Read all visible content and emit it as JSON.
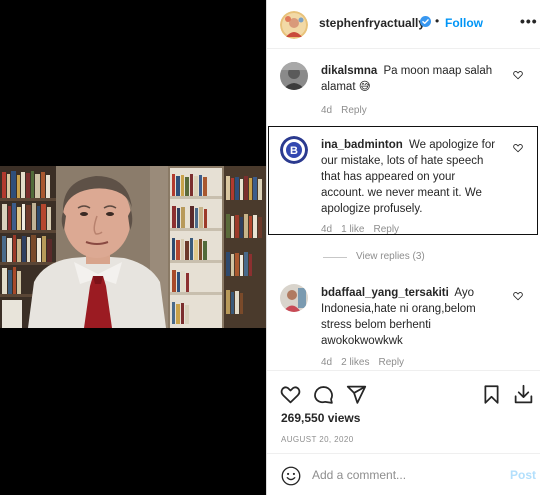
{
  "post": {
    "username": "stephenfryactually",
    "dot": "•",
    "follow_label": "Follow",
    "more_label": "•••"
  },
  "comments": [
    {
      "username": "dikalsmna",
      "text": "Pa moon maap salah alamat 😅",
      "age": "4d",
      "likes": "",
      "reply_label": "Reply"
    },
    {
      "username": "ina_badminton",
      "text": "We apologize for our mistake, lots of hate speech that has appeared on your account. we never meant it. We apologize profusely.",
      "age": "4d",
      "likes": "1 like",
      "reply_label": "Reply"
    },
    {
      "username": "bdaffaal_yang_tersakiti",
      "text": "Ayo Indonesia,hate ni orang,belom stress belom berhenti awokokwowkwk",
      "age": "4d",
      "likes": "2 likes",
      "reply_label": "Reply"
    }
  ],
  "view_replies_label": "View replies (3)",
  "stats": {
    "views": "269,550 views",
    "date": "AUGUST 20, 2020"
  },
  "add_comment": {
    "placeholder": "Add a comment...",
    "post_label": "Post"
  },
  "colors": {
    "accent": "#0095f6",
    "post_disabled": "#b2dffc",
    "muted": "#8e8e8e",
    "text": "#262626"
  },
  "icons": [
    "heart-icon",
    "comment-icon",
    "share-icon",
    "bookmark-icon",
    "download-icon",
    "emoji-icon",
    "verified-icon",
    "more-icon"
  ]
}
